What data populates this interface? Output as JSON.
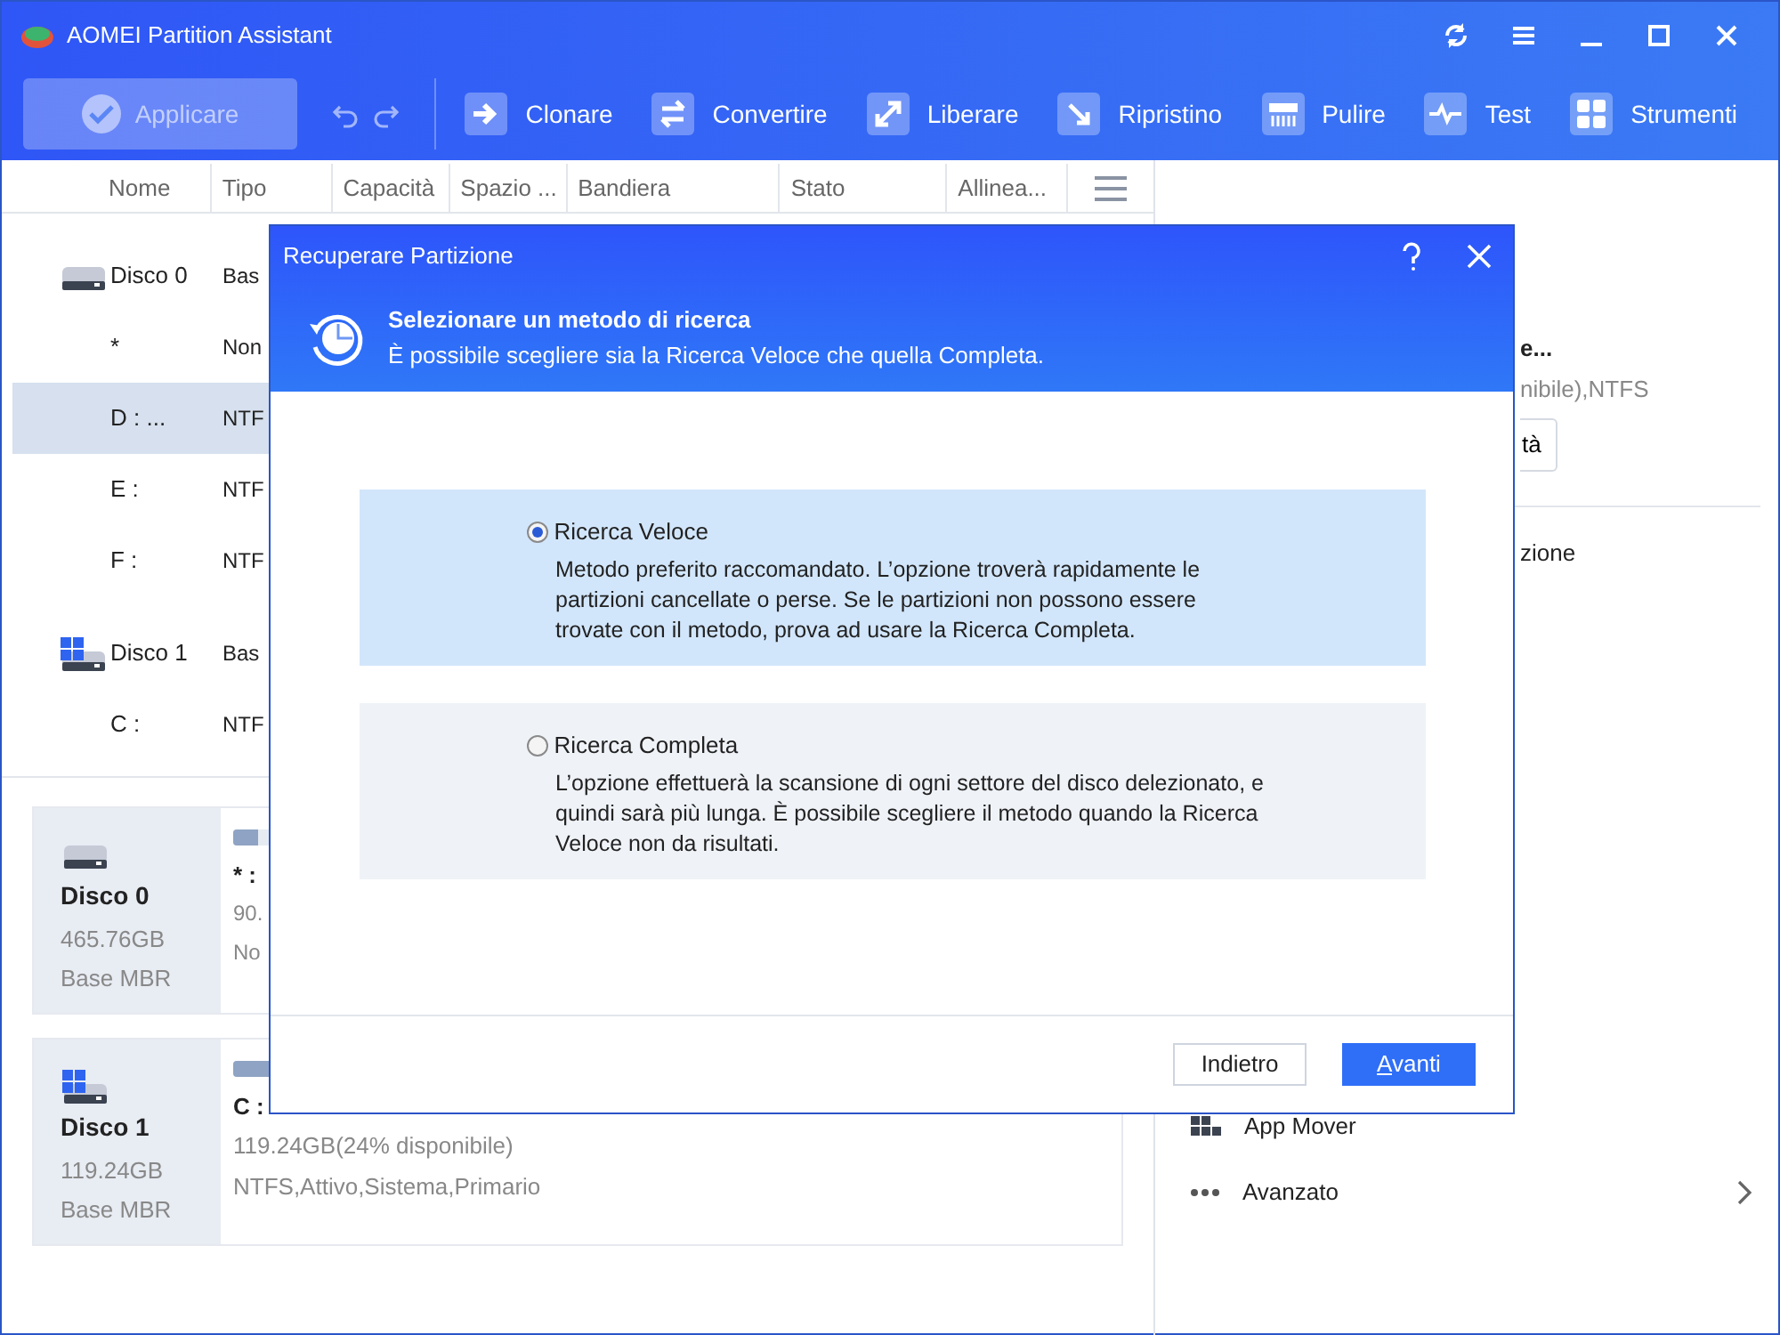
{
  "window": {
    "title": "AOMEI Partition Assistant"
  },
  "toolbar": {
    "apply": {
      "label": "Applicare",
      "disabled": true
    },
    "tools": [
      {
        "label": "Clonare"
      },
      {
        "label": "Convertire"
      },
      {
        "label": "Liberare"
      },
      {
        "label": "Ripristino"
      },
      {
        "label": "Pulire"
      },
      {
        "label": "Test"
      },
      {
        "label": "Strumenti"
      }
    ]
  },
  "table": {
    "columns": [
      "Nome",
      "Tipo",
      "Capacità",
      "Spazio ...",
      "Bandiera",
      "Stato",
      "Allinea..."
    ],
    "rows": [
      {
        "kind": "disk",
        "name": "Disco 0",
        "type": "Bas",
        "system": false,
        "selected": false
      },
      {
        "kind": "partition",
        "name": "*",
        "type": "Non",
        "selected": false
      },
      {
        "kind": "partition",
        "name": "D : ...",
        "type": "NTF",
        "selected": true
      },
      {
        "kind": "partition",
        "name": "E :",
        "type": "NTF",
        "selected": false
      },
      {
        "kind": "partition",
        "name": "F :",
        "type": "NTF",
        "selected": false
      },
      {
        "kind": "disk",
        "name": "Disco 1",
        "type": "Bas",
        "system": true,
        "selected": false
      },
      {
        "kind": "partition",
        "name": "C :",
        "type": "NTF",
        "selected": false
      }
    ]
  },
  "disk_cards": [
    {
      "name": "Disco 0",
      "size": "465.76GB",
      "style": "Base MBR",
      "system": false,
      "partition": {
        "name": "* :",
        "size": "90.",
        "info": "No",
        "level": 0.1
      }
    },
    {
      "name": "Disco 1",
      "size": "119.24GB",
      "style": "Base MBR",
      "system": true,
      "partition": {
        "name": "C :",
        "size": "119.24GB(24% disponibile)",
        "info": "NTFS,Attivo,Sistema,Primario",
        "level": 0.76
      }
    }
  ],
  "side_panel": {
    "title": "e...",
    "detail": "nibile),NTFS",
    "button": "tà",
    "items": [
      {
        "label": "zione",
        "kind": "plain"
      },
      {
        "label": "App Mover",
        "kind": "apps"
      },
      {
        "label": "Avanzato",
        "kind": "more",
        "submenu": true
      }
    ]
  },
  "dialog": {
    "title": "Recuperare Partizione",
    "heading": "Selezionare un metodo di ricerca",
    "subheading": "È possibile scegliere sia la Ricerca Veloce che quella Completa.",
    "options": [
      {
        "label": "Ricerca Veloce",
        "description": "Metodo preferito raccomandato. L’opzione troverà rapidamente le partizioni cancellate o perse. Se le partizioni non possono essere trovate con il metodo, prova ad usare la Ricerca Completa.",
        "selected": true
      },
      {
        "label": "Ricerca Completa",
        "description": "L’opzione effettuerà la scansione di ogni settore del disco delezionato, e quindi sarà più lunga. È possibile scegliere il metodo quando la Ricerca Veloce non da risultati.",
        "selected": false
      }
    ],
    "buttons": [
      {
        "label": "Indietro",
        "primary": false
      },
      {
        "label": "Avanti",
        "primary": true
      }
    ]
  }
}
